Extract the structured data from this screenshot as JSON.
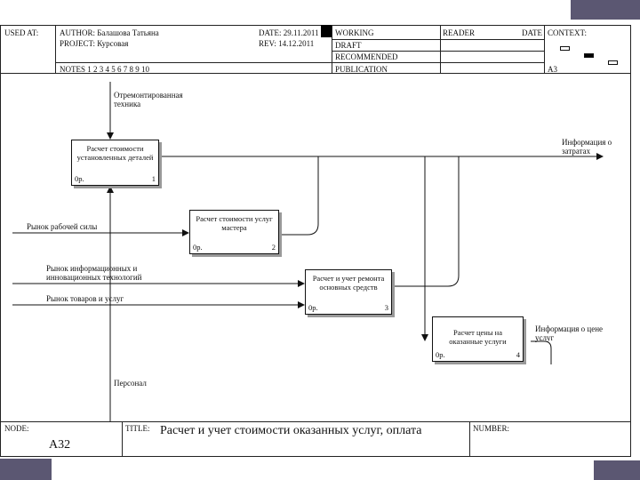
{
  "header": {
    "used_at": "USED AT:",
    "author": "AUTHOR: Балашова Татьяна",
    "project": "PROJECT: Курсовая",
    "date": "DATE: 29.11.2011",
    "rev": "REV: 14.12.2011",
    "notes": "NOTES 1 2 3 4 5 6 7 8 9 10",
    "working": "WORKING",
    "draft": "DRAFT",
    "recommended": "RECOMMENDED",
    "publication": "PUBLICATION",
    "reader": "READER",
    "reader_date": "DATE",
    "context": "CONTEXT:",
    "context_node": "А3"
  },
  "boxes": [
    {
      "label": "Расчет стоимости установленных деталей",
      "cost": "0р.",
      "num": "1"
    },
    {
      "label": "Расчет стоимости услуг мастера",
      "cost": "0р.",
      "num": "2"
    },
    {
      "label": "Расчет и учет ремонта основных средств",
      "cost": "0р.",
      "num": "3"
    },
    {
      "label": "Расчет цены на оказанные услуги",
      "cost": "0р.",
      "num": "4"
    }
  ],
  "arrows": {
    "control_top": "Отремонтированная техника",
    "output_info": "Информация о затратах",
    "input_labor": "Рынок рабочей силы",
    "input_it": "Рынок информационных и инновационных технологий",
    "input_goods": "Рынок товаров и услуг",
    "output_price": "Информация о цене услуг",
    "mechanism": "Персонал"
  },
  "footer": {
    "node_label": "NODE:",
    "node_value": "А32",
    "title_label": "TITLE:",
    "title_value": "Расчет и учет стоимости оказанных услуг, оплата",
    "number_label": "NUMBER:"
  },
  "colors": {
    "accent": "#5b5772",
    "line": "#111111"
  }
}
